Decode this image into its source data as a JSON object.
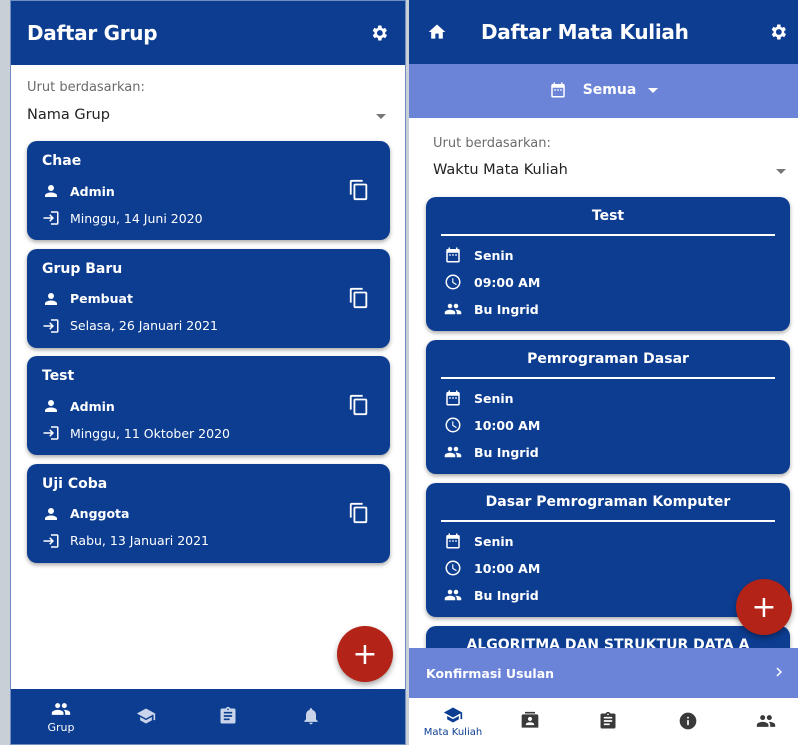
{
  "left": {
    "title": "Daftar Grup",
    "sort_label": "Urut berdasarkan:",
    "sort_value": "Nama Grup",
    "groups": [
      {
        "name": "Chae",
        "role": "Admin",
        "date": "Minggu, 14 Juni 2020"
      },
      {
        "name": "Grup Baru",
        "role": "Pembuat",
        "date": "Selasa, 26 Januari 2021"
      },
      {
        "name": "Test",
        "role": "Admin",
        "date": "Minggu, 11 Oktober 2020"
      },
      {
        "name": "Uji Coba",
        "role": "Anggota",
        "date": "Rabu, 13 Januari 2021"
      }
    ],
    "fab_label": "+",
    "nav": [
      {
        "label": "Grup",
        "icon": "people-icon",
        "active": true
      },
      {
        "label": "",
        "icon": "school-icon",
        "active": false
      },
      {
        "label": "",
        "icon": "clipboard-icon",
        "active": false
      },
      {
        "label": "",
        "icon": "bell-icon",
        "active": false
      }
    ],
    "nav_bg": "#0c3d91"
  },
  "right": {
    "title": "Daftar Mata Kuliah",
    "filter_label": "Semua",
    "sort_label": "Urut berdasarkan:",
    "sort_value": "Waktu Mata Kuliah",
    "courses": [
      {
        "title": "Test",
        "day": "Senin",
        "time": "09:00 AM",
        "lecturer": "Bu Ingrid"
      },
      {
        "title": "Pemrograman Dasar",
        "day": "Senin",
        "time": "10:00 AM",
        "lecturer": "Bu Ingrid"
      },
      {
        "title": "Dasar Pemrograman Komputer",
        "day": "Senin",
        "time": "10:00 AM",
        "lecturer": "Bu Ingrid"
      },
      {
        "title": "ALGORITMA DAN STRUKTUR DATA A",
        "day": "",
        "time": "",
        "lecturer": ""
      }
    ],
    "fab_label": "+",
    "confirm_label": "Konfirmasi Usulan",
    "nav": [
      {
        "label": "Mata Kuliah",
        "icon": "school-icon",
        "active": true
      },
      {
        "label": "",
        "icon": "contact-card-icon",
        "active": false
      },
      {
        "label": "",
        "icon": "clipboard-icon",
        "active": false
      },
      {
        "label": "",
        "icon": "info-icon",
        "active": false
      },
      {
        "label": "",
        "icon": "people-icon",
        "active": false
      }
    ]
  },
  "colors": {
    "primary": "#0c3d91",
    "accent_bar": "#6b84d8",
    "fab": "#b32317"
  }
}
